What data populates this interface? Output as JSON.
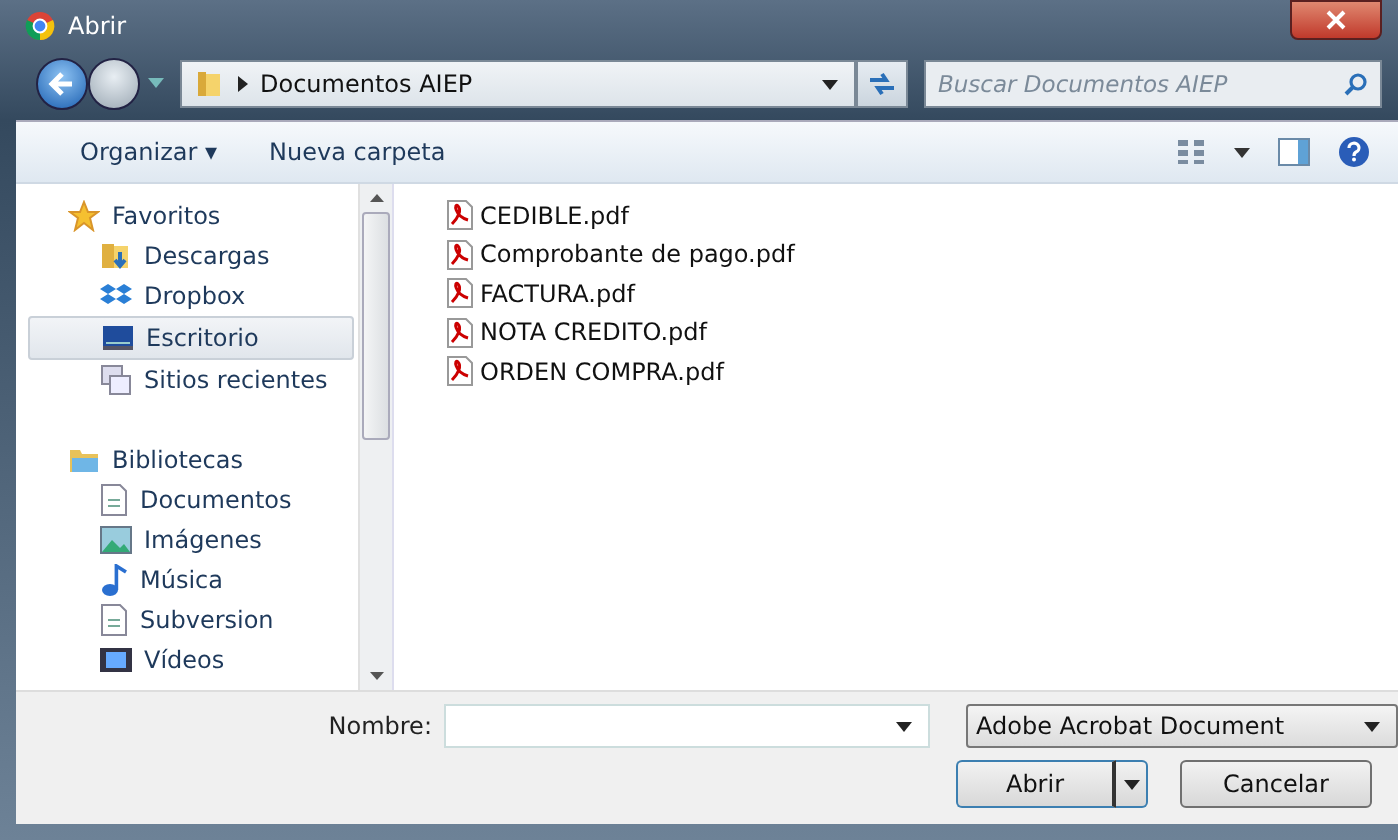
{
  "window": {
    "title": "Abrir"
  },
  "address": {
    "path": "Documentos AIEP",
    "search_placeholder": "Buscar Documentos AIEP"
  },
  "toolbar": {
    "organize": "Organizar ▾",
    "new_folder": "Nueva carpeta"
  },
  "sidebar": {
    "groups": [
      {
        "label": "Favoritos",
        "children": [
          {
            "label": "Descargas",
            "selected": false
          },
          {
            "label": "Dropbox",
            "selected": false
          },
          {
            "label": "Escritorio",
            "selected": true
          },
          {
            "label": "Sitios recientes",
            "selected": false
          }
        ]
      },
      {
        "label": "Bibliotecas",
        "children": [
          {
            "label": "Documentos",
            "selected": false
          },
          {
            "label": "Imágenes",
            "selected": false
          },
          {
            "label": "Música",
            "selected": false
          },
          {
            "label": "Subversion",
            "selected": false
          },
          {
            "label": "Vídeos",
            "selected": false
          }
        ]
      }
    ]
  },
  "files": [
    {
      "name": "CEDIBLE.pdf"
    },
    {
      "name": "Comprobante de pago.pdf"
    },
    {
      "name": "FACTURA.pdf"
    },
    {
      "name": "NOTA CREDITO.pdf"
    },
    {
      "name": "ORDEN COMPRA.pdf"
    }
  ],
  "footer": {
    "name_label": "Nombre:",
    "file_type": "Adobe Acrobat Document",
    "open_button": "Abrir",
    "cancel_button": "Cancelar"
  }
}
